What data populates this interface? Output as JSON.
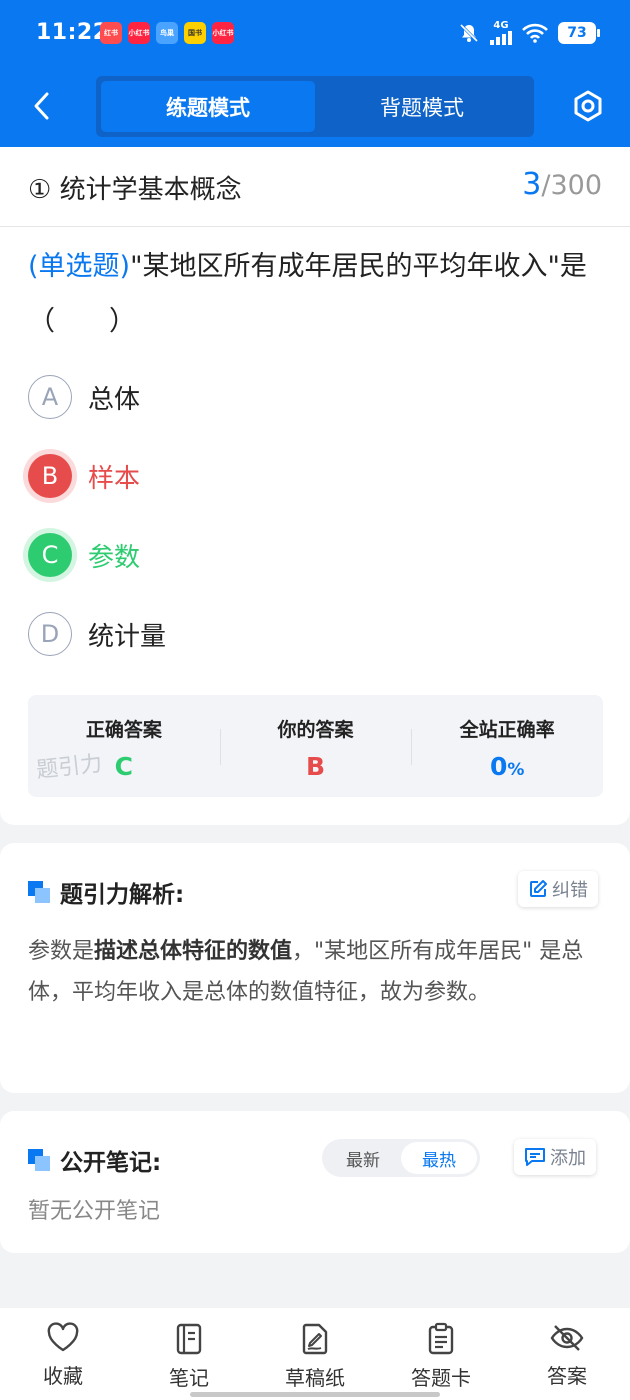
{
  "status_bar": {
    "time": "11:22",
    "network": "4G",
    "battery": "73",
    "app_icons": [
      "红书",
      "小红书",
      "鸟巢",
      "国书",
      "小红书"
    ]
  },
  "header": {
    "tabs": [
      {
        "label": "练题模式",
        "active": true
      },
      {
        "label": "背题模式",
        "active": false
      }
    ],
    "accent_color": "#0a78f0"
  },
  "question": {
    "chapter": "① 统计学基本概念",
    "current": "3",
    "total": "/300",
    "type": "(单选题)",
    "text": "\"某地区所有成年居民的平均年收入\"是（　　）",
    "options": [
      {
        "letter": "A",
        "label": "总体",
        "state": "normal"
      },
      {
        "letter": "B",
        "label": "样本",
        "state": "wrong"
      },
      {
        "letter": "C",
        "label": "参数",
        "state": "correct"
      },
      {
        "letter": "D",
        "label": "统计量",
        "state": "normal"
      }
    ]
  },
  "answer_summary": {
    "correct_label": "正确答案",
    "correct_value": "C",
    "yours_label": "你的答案",
    "yours_value": "B",
    "rate_label": "全站正确率",
    "rate_value": "0",
    "rate_unit": "%",
    "watermark": "题引力"
  },
  "analysis": {
    "title": "题引力解析:",
    "report_label": "纠错",
    "text_prefix": "参数是",
    "text_bold": "描述总体特征的数值",
    "text_rest": "，\"某地区所有成年居民\" 是总体，平均年收入是总体的数值特征，故为参数。"
  },
  "notes": {
    "title": "公开笔记:",
    "sort_options": [
      {
        "label": "最新",
        "active": false
      },
      {
        "label": "最热",
        "active": true
      }
    ],
    "add_label": "添加",
    "empty_text": "暂无公开笔记"
  },
  "bottom_nav": [
    {
      "label": "收藏",
      "icon": "heart-icon"
    },
    {
      "label": "笔记",
      "icon": "notebook-icon"
    },
    {
      "label": "草稿纸",
      "icon": "draft-paper-icon"
    },
    {
      "label": "答题卡",
      "icon": "answer-card-icon"
    },
    {
      "label": "答案",
      "icon": "eye-off-icon"
    }
  ]
}
